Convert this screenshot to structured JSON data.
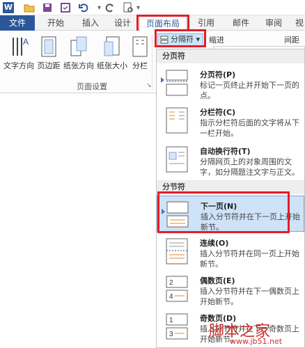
{
  "qat": {
    "logo": "W",
    "icons": [
      "word-logo",
      "folder-icon",
      "save-icon",
      "format-icon",
      "undo-icon",
      "redo-icon",
      "print-preview-icon"
    ]
  },
  "tabs": {
    "file": "文件",
    "home": "开始",
    "insert": "插入",
    "design": "设计",
    "layout": "页面布局",
    "references": "引用",
    "mailings": "邮件",
    "review": "审阅",
    "view": "视"
  },
  "ribbon": {
    "text_direction": "文字方向",
    "margins": "页边距",
    "orientation": "纸张方向",
    "size": "纸张大小",
    "columns": "分栏",
    "group_label": "页面设置",
    "breaks": "分隔符",
    "indent": "缩进",
    "spacing": "间距"
  },
  "menu": {
    "page_breaks_header": "分页符",
    "section_breaks_header": "分节符",
    "items": [
      {
        "title": "分页符(P)",
        "desc": "标记一页终止并开始下一页的点。"
      },
      {
        "title": "分栏符(C)",
        "desc": "指示分栏符后面的文字将从下一栏开始。"
      },
      {
        "title": "自动换行符(T)",
        "desc": "分隔网页上的对象周围的文字，如分隔题注文字与正文。"
      },
      {
        "title": "下一页(N)",
        "desc": "插入分节符并在下一页上开始新节。"
      },
      {
        "title": "连续(O)",
        "desc": "插入分节符并在同一页上开始新节。"
      },
      {
        "title": "偶数页(E)",
        "desc": "插入分节符并在下一偶数页上开始新节。"
      },
      {
        "title": "奇数页(D)",
        "desc": "插入分节符并在下一奇数页上开始新节。"
      }
    ]
  },
  "watermark": {
    "brand": "脚本之家",
    "url": "www.jb51.net"
  },
  "colors": {
    "accent": "#2b579a",
    "highlight": "#e21d2b",
    "selection": "#cfe3f8"
  }
}
